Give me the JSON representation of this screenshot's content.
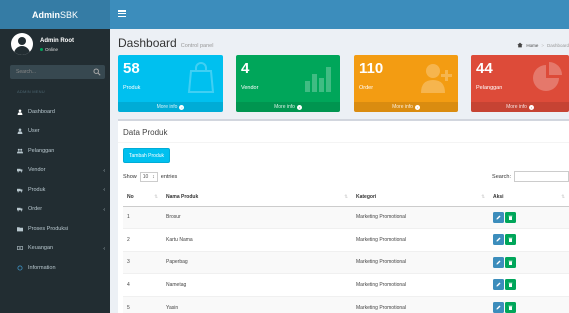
{
  "header": {
    "logo_bold": "Admin",
    "logo_light": "SBK"
  },
  "sidebar": {
    "user_name": "Admin Root",
    "user_status": "Online",
    "search_placeholder": "Search...",
    "menu_header": "ADMIN MENU",
    "items": [
      {
        "label": "Dashboard",
        "icon": "dashboard-icon"
      },
      {
        "label": "User",
        "icon": "user-icon"
      },
      {
        "label": "Pelanggan",
        "icon": "users-icon"
      },
      {
        "label": "Vendor",
        "icon": "truck-icon"
      },
      {
        "label": "Produk",
        "icon": "truck-icon"
      },
      {
        "label": "Order",
        "icon": "truck-icon"
      },
      {
        "label": "Proses Produksi",
        "icon": "folder-icon"
      },
      {
        "label": "Keuangan",
        "icon": "money-icon"
      },
      {
        "label": "Information",
        "icon": "circle-icon"
      }
    ]
  },
  "content_header": {
    "title": "Dashboard",
    "subtitle": "Control panel",
    "breadcrumb_home": "Home",
    "breadcrumb_active": "Dashboard"
  },
  "stat_boxes": [
    {
      "value": "58",
      "label": "Produk",
      "footer": "More info",
      "color": "#00c0ef",
      "icon": "shopping-bag-icon"
    },
    {
      "value": "4",
      "label": "Vendor",
      "footer": "More info",
      "color": "#00a65a",
      "icon": "bar-chart-icon"
    },
    {
      "value": "110",
      "label": "Order",
      "footer": "More info",
      "color": "#f39c12",
      "icon": "person-add-icon"
    },
    {
      "value": "44",
      "label": "Pelanggan",
      "footer": "More info",
      "color": "#dd4b39",
      "icon": "pie-chart-icon"
    }
  ],
  "data_box": {
    "title": "Data Produk",
    "add_button": "Tambah Produk",
    "show_label": "Show",
    "entries_value": "10",
    "entries_label": "entries",
    "search_label": "Search:",
    "columns": [
      "No",
      "Nama Produk",
      "Kategori",
      "Aksi"
    ],
    "rows": [
      {
        "no": "1",
        "nama": "Brosur",
        "kategori": "Marketing Promotional"
      },
      {
        "no": "2",
        "nama": "Kartu Nama",
        "kategori": "Marketing Promotional"
      },
      {
        "no": "3",
        "nama": "Paperbag",
        "kategori": "Marketing Promotional"
      },
      {
        "no": "4",
        "nama": "Nametag",
        "kategori": "Marketing Promotional"
      },
      {
        "no": "5",
        "nama": "Yasin",
        "kategori": "Marketing Promotional"
      }
    ]
  }
}
